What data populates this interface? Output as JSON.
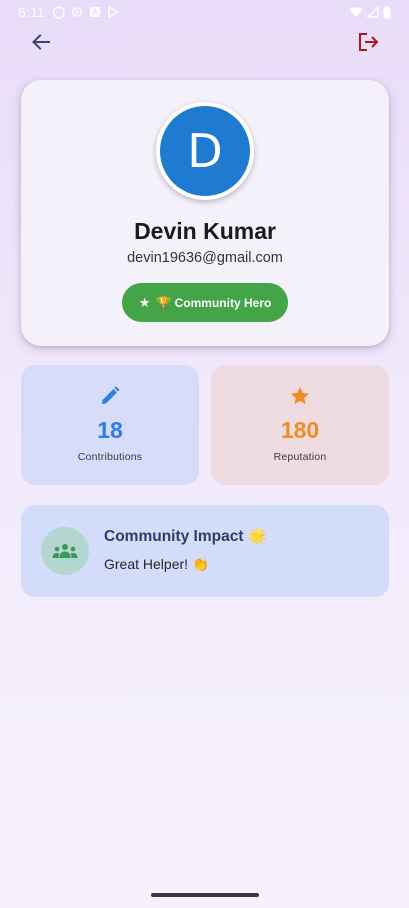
{
  "status_bar": {
    "time": "6:11"
  },
  "profile": {
    "avatar_initial": "D",
    "name": "Devin Kumar",
    "email": "devin19636@gmail.com",
    "badge_star": "★",
    "badge_label": "🏆 Community Hero",
    "badge_color": "#43a548",
    "avatar_color": "#1f7ad1"
  },
  "stats": [
    {
      "icon": "pencil-icon",
      "value": "18",
      "label": "Contributions",
      "color": "#2e7fe0"
    },
    {
      "icon": "star-icon",
      "value": "180",
      "label": "Reputation",
      "color": "#f08c25"
    }
  ],
  "impact": {
    "icon": "groups-icon",
    "title": "Community Impact 🌟",
    "subtitle": "Great Helper! 👏"
  },
  "colors": {
    "back_arrow": "#3b4475",
    "logout": "#b01a1a"
  }
}
